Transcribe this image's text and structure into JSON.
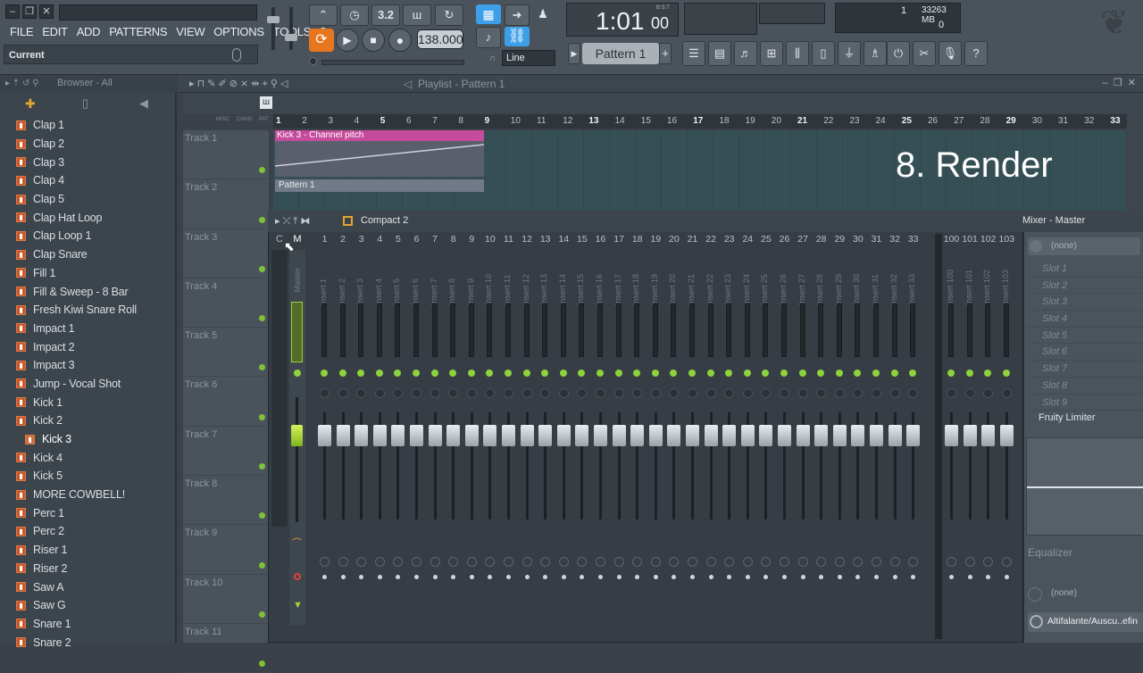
{
  "window_buttons": [
    "–",
    "❐",
    "✕"
  ],
  "menu": [
    "FILE",
    "EDIT",
    "ADD",
    "PATTERNS",
    "VIEW",
    "OPTIONS",
    "TOOLS",
    "?"
  ],
  "hint": {
    "label": "Current"
  },
  "transport": {
    "tempo": "138.000",
    "time_main": "1:01",
    "time_sub": "00",
    "time_tag": "B:S:T",
    "snap": "Line",
    "pattern": "Pattern 1",
    "cpu_label": "1",
    "memory": "33263 MB",
    "poly": "0",
    "small_display": "3.2"
  },
  "browser": {
    "title": "Browser - All",
    "items": [
      "Clap 1",
      "Clap 2",
      "Clap 3",
      "Clap 4",
      "Clap 5",
      "Clap Hat Loop",
      "Clap Loop 1",
      "Clap Snare",
      "Fill 1",
      "Fill & Sweep - 8 Bar",
      "Fresh Kiwi Snare Roll",
      "Impact 1",
      "Impact 2",
      "Impact 3",
      "Jump - Vocal Shot",
      "Kick 1",
      "Kick 2",
      "Kick 3",
      "Kick 4",
      "Kick 5",
      "MORE COWBELL!",
      "Perc 1",
      "Perc 2",
      "Riser 1",
      "Riser 2",
      "Saw A",
      "Saw G",
      "Snare 1",
      "Snare 2"
    ],
    "selected": "Kick 3"
  },
  "playlist": {
    "title": "Playlist - Pattern 1",
    "ruler": [
      "1",
      "2",
      "3",
      "4",
      "5",
      "6",
      "7",
      "8",
      "9",
      "10",
      "11",
      "12",
      "13",
      "14",
      "15",
      "16",
      "17",
      "18",
      "19",
      "20",
      "21",
      "22",
      "23",
      "24",
      "25",
      "26",
      "27",
      "28",
      "29",
      "30",
      "31",
      "32",
      "33"
    ],
    "tracks": [
      "Track 1",
      "Track 2",
      "Track 3",
      "Track 4",
      "Track 5",
      "Track 6",
      "Track 7",
      "Track 8",
      "Track 9",
      "Track 10",
      "Track 11"
    ],
    "clip_automation": "Kick 3 - Channel pitch",
    "clip_pattern": "Pattern 1",
    "header_tabs": [
      "MISC",
      "CHAN",
      "PAT"
    ]
  },
  "overlay_text": "8. Render",
  "mixer": {
    "layout": "Compact 2",
    "title": "Mixer - Master",
    "master_label": "M",
    "c_label": "C",
    "inserts": [
      "1",
      "2",
      "3",
      "4",
      "5",
      "6",
      "7",
      "8",
      "9",
      "10",
      "11",
      "12",
      "13",
      "14",
      "15",
      "16",
      "17",
      "18",
      "19",
      "20",
      "21",
      "22",
      "23",
      "24",
      "25",
      "26",
      "27",
      "28",
      "29",
      "30",
      "31",
      "32",
      "33"
    ],
    "extra_inserts": [
      "100",
      "101",
      "102",
      "103"
    ],
    "insert_prefix": "Insert",
    "master_name": "Master",
    "none_label": "(none)",
    "slots": [
      "Slot 1",
      "Slot 2",
      "Slot 3",
      "Slot 4",
      "Slot 5",
      "Slot 6",
      "Slot 7",
      "Slot 8",
      "Slot 9"
    ],
    "plugin": "Fruity Limiter",
    "eq_label": "Equalizer",
    "none_bottom": "(none)",
    "output": "Altifalante/Auscu..efin"
  },
  "colors": {
    "accent_orange": "#e8761f",
    "clip_pink": "#c74b9c",
    "led_green": "#8fd23d"
  }
}
